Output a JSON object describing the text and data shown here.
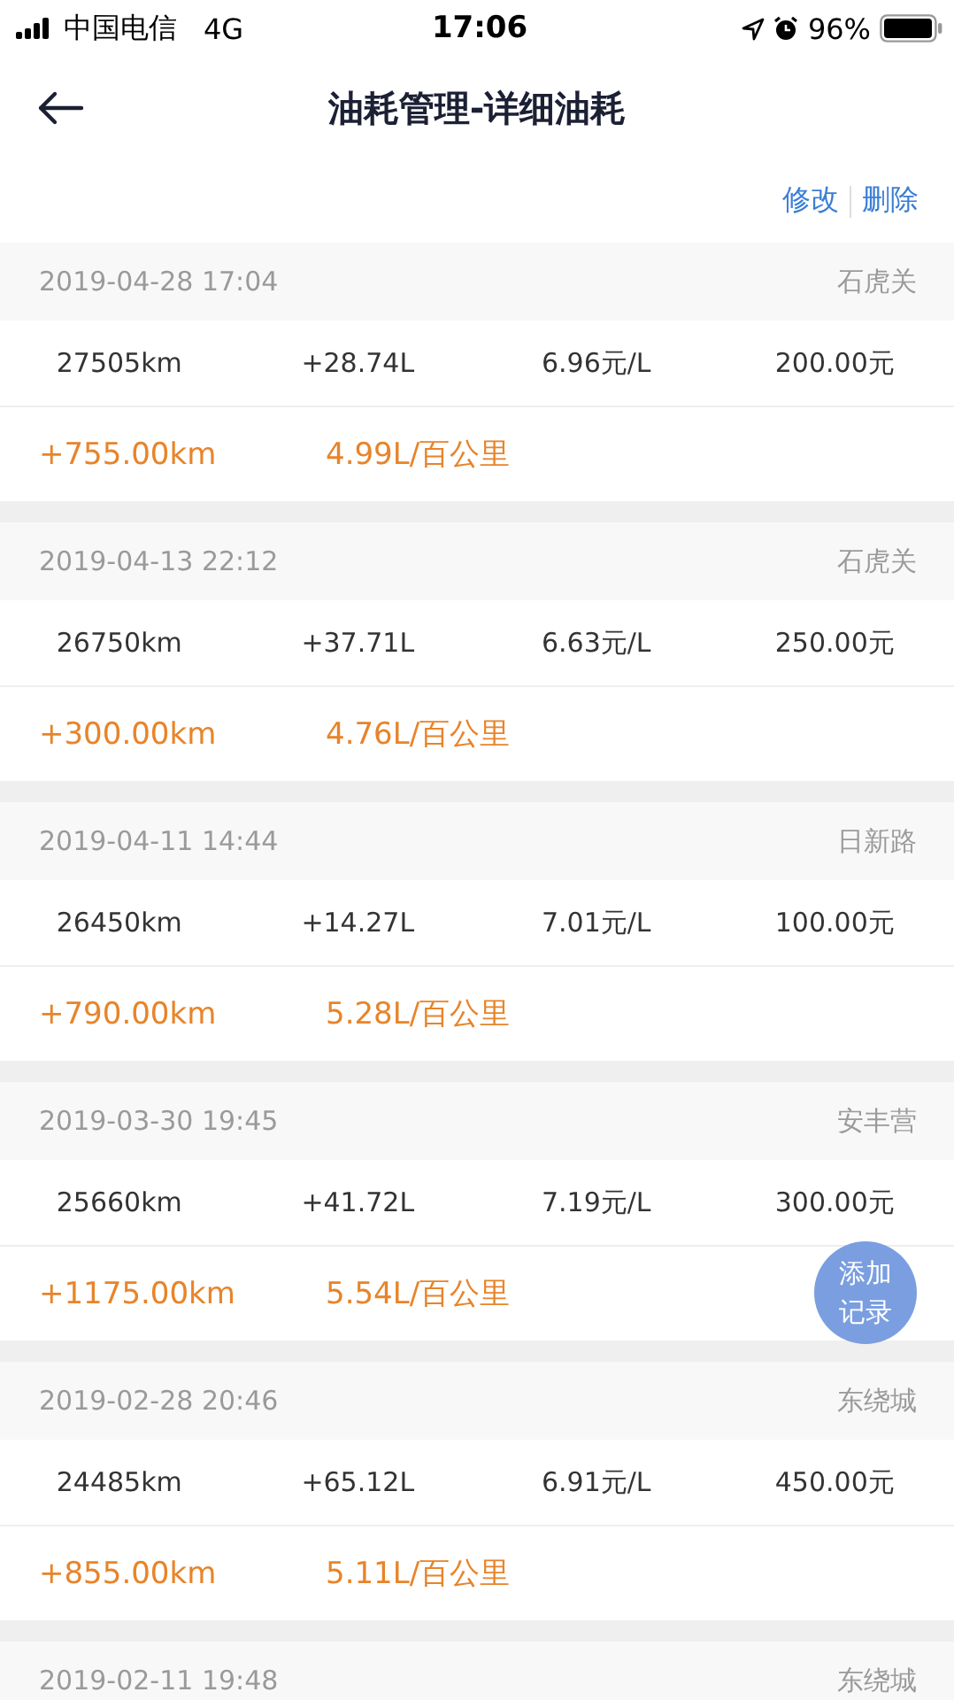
{
  "status_bar": {
    "carrier": "中国电信",
    "network": "4G",
    "time": "17:06",
    "battery": "96%"
  },
  "nav": {
    "title": "油耗管理-详细油耗"
  },
  "actions": [
    "修改",
    "删除"
  ],
  "records": [
    {
      "datetime": "2019-04-28 17:04",
      "station": "石虎关",
      "odometer": "27505km",
      "fuel": "+28.74L",
      "price": "6.96元/L",
      "amount": "200.00元",
      "distance": "+755.00km",
      "consumption": "4.99L/百公里"
    },
    {
      "datetime": "2019-04-13 22:12",
      "station": "石虎关",
      "odometer": "26750km",
      "fuel": "+37.71L",
      "price": "6.63元/L",
      "amount": "250.00元",
      "distance": "+300.00km",
      "consumption": "4.76L/百公里"
    },
    {
      "datetime": "2019-04-11 14:44",
      "station": "日新路",
      "odometer": "26450km",
      "fuel": "+14.27L",
      "price": "7.01元/L",
      "amount": "100.00元",
      "distance": "+790.00km",
      "consumption": "5.28L/百公里"
    },
    {
      "datetime": "2019-03-30 19:45",
      "station": "安丰营",
      "odometer": "25660km",
      "fuel": "+41.72L",
      "price": "7.19元/L",
      "amount": "300.00元",
      "distance": "+1175.00km",
      "consumption": "5.54L/百公里"
    },
    {
      "datetime": "2019-02-28 20:46",
      "station": "东绕城",
      "odometer": "24485km",
      "fuel": "+65.12L",
      "price": "6.91元/L",
      "amount": "450.00元",
      "distance": "+855.00km",
      "consumption": "5.11L/百公里"
    },
    {
      "datetime": "2019-02-11 19:48",
      "station": "东绕城"
    }
  ],
  "fab": {
    "label_line_1": "添加",
    "label_line_2": "记录"
  }
}
